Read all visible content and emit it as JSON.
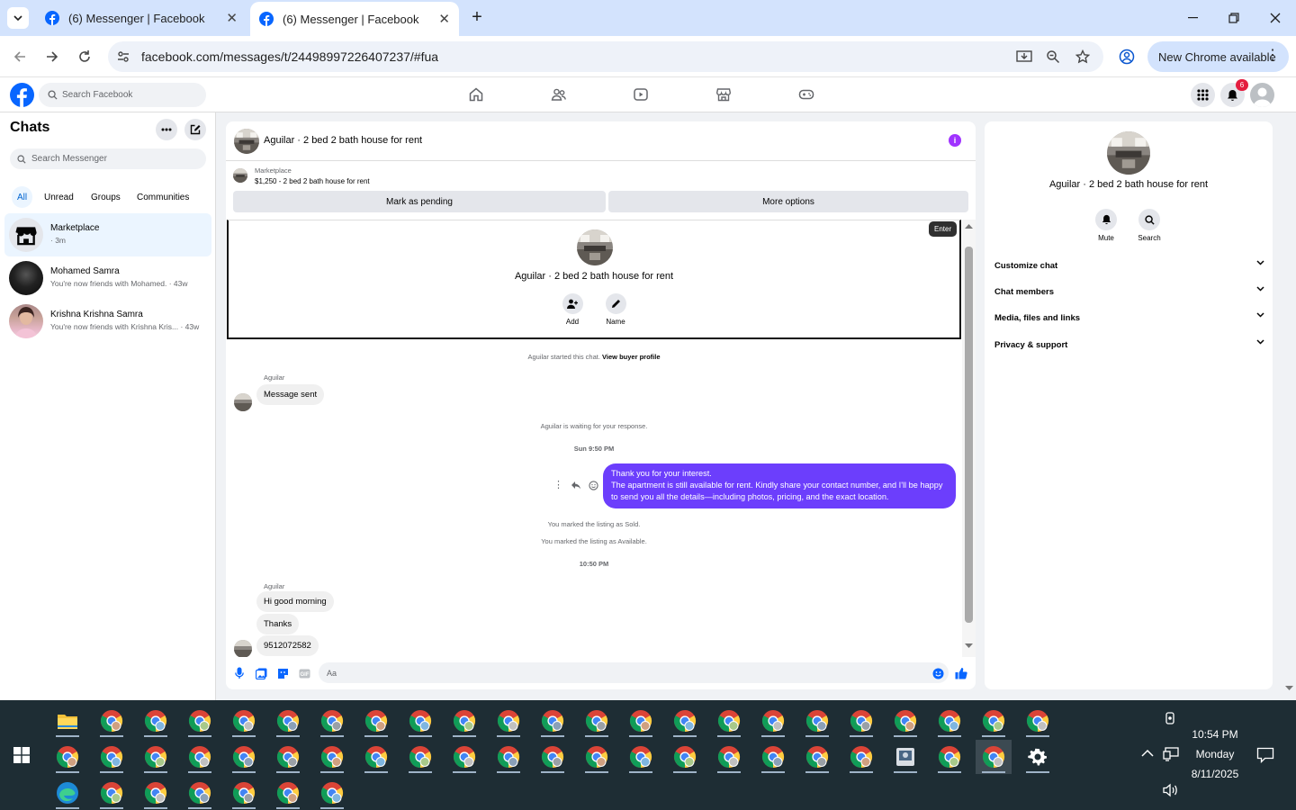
{
  "browser": {
    "tabs": [
      {
        "title": "(6) Messenger | Facebook",
        "active": false
      },
      {
        "title": "(6) Messenger | Facebook",
        "active": true
      }
    ],
    "url": "facebook.com/messages/t/24498997226407237/#fua",
    "update_label": "New Chrome available",
    "new_tab": "+",
    "tab_close": "✕"
  },
  "fb": {
    "search_placeholder": "Search Facebook",
    "notif_count": "6",
    "brand_color": "#0866ff"
  },
  "sidebar": {
    "title": "Chats",
    "search_placeholder": "Search Messenger",
    "filters": [
      "All",
      "Unread",
      "Groups",
      "Communities"
    ],
    "chats": [
      {
        "name": "Marketplace",
        "preview": "· 3m",
        "selected": true
      },
      {
        "name": "Mohamed Samra",
        "preview": "You're now friends with Mohamed. · 43w"
      },
      {
        "name": "Krishna Krishna Samra",
        "preview": "You're now friends with Krishna Kris... · 43w"
      }
    ]
  },
  "chat": {
    "title": "Aguilar · 2 bed 2 bath house for rent",
    "marketplace_label": "Marketplace",
    "listing": "$1,250 - 2 bed 2 bath house for rent",
    "mark_pending": "Mark as pending",
    "more_options": "More options",
    "tooltip": "Enter",
    "profile_name": "Aguilar · 2 bed 2 bath house for rent",
    "add_label": "Add",
    "name_label": "Name",
    "started_text": "Aguilar started this chat.",
    "view_buyer": "View buyer profile",
    "sender": "Aguilar",
    "msg1": "Message sent",
    "waiting": "Aguilar is waiting for your response.",
    "time1": "Sun 9:50 PM",
    "my_msg_line1": "Thank you for your interest.",
    "my_msg_line2": "The apartment is still available for rent. Kindly share your contact number, and I'll be happy to send you all the details—including photos, pricing, and the exact location.",
    "sold": "You marked the listing as Sold.",
    "available": "You marked the listing as Available.",
    "time2": "10:50 PM",
    "msg2": "Hi good morning",
    "msg3": "Thanks",
    "msg4": "9512072582",
    "composer_placeholder": "Aa",
    "accent": "#6c3efc"
  },
  "details": {
    "name": "Aguilar · 2 bed 2 bath house for rent",
    "mute": "Mute",
    "search": "Search",
    "sections": [
      "Customize chat",
      "Chat members",
      "Media, files and links",
      "Privacy & support"
    ]
  },
  "taskbar": {
    "time": "10:54 PM",
    "day": "Monday",
    "date": "8/11/2025"
  }
}
